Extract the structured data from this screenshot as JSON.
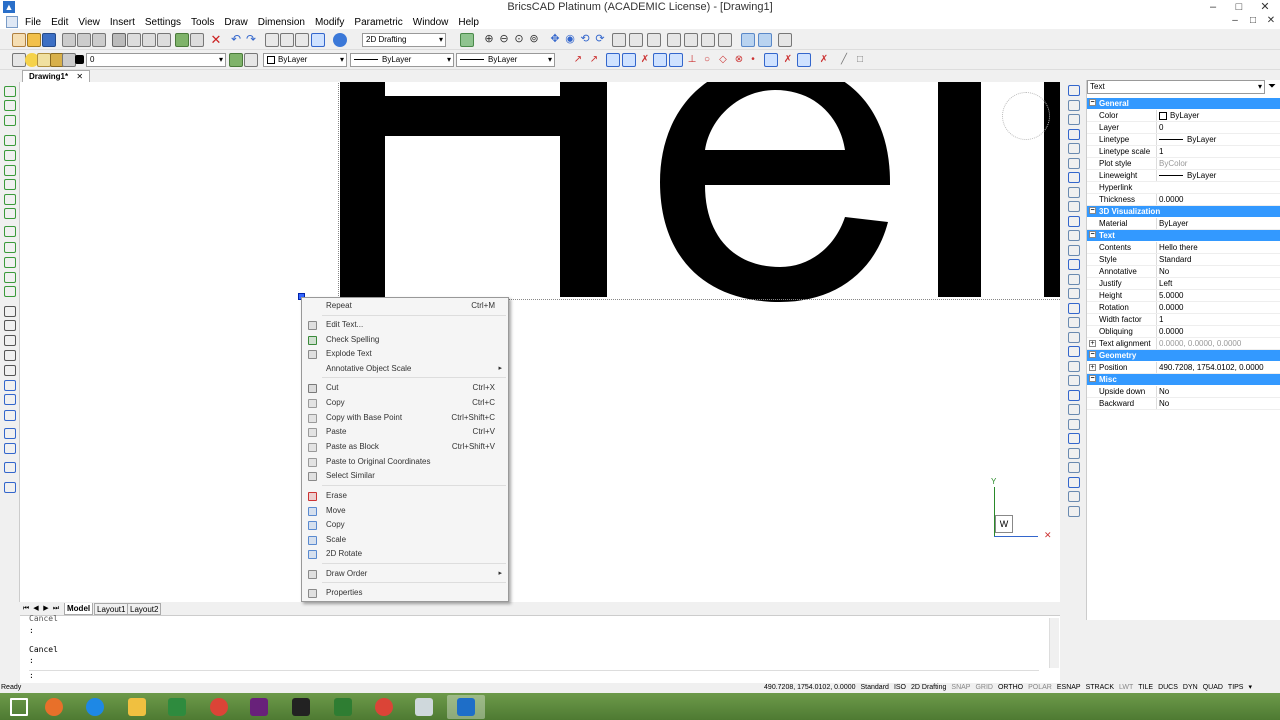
{
  "window": {
    "title": "BricsCAD Platinum (ACADEMIC License) - [Drawing1]",
    "min": "–",
    "max": "□",
    "close": "✕",
    "mdi_min": "–",
    "mdi_max": "□",
    "mdi_close": "✕"
  },
  "menu": [
    "File",
    "Edit",
    "View",
    "Insert",
    "Settings",
    "Tools",
    "Draw",
    "Dimension",
    "Modify",
    "Parametric",
    "Window",
    "Help"
  ],
  "toolbar": {
    "workspace": "2D Drafting",
    "layer": "0",
    "color": "ByLayer",
    "linetype": "ByLayer",
    "lineweight": "ByLayer"
  },
  "doc_tab": {
    "label": "Drawing1*",
    "close": "✕"
  },
  "drawing_text": "Hello there",
  "context_menu": {
    "items": [
      {
        "label": "Repeat",
        "shortcut": "Ctrl+M",
        "icon_color": ""
      },
      {
        "label": "Edit Text...",
        "shortcut": "",
        "icon_color": "#8a8a8a"
      },
      {
        "label": "Check Spelling",
        "shortcut": "",
        "icon_color": "#3a8a3a"
      },
      {
        "label": "Explode Text",
        "shortcut": "",
        "icon_color": "#8a8a8a"
      },
      {
        "label": "Annotative Object Scale",
        "shortcut": "",
        "icon_color": "",
        "submenu": "▸"
      },
      {
        "label": "Cut",
        "shortcut": "Ctrl+X",
        "icon_color": "#7a7a7a"
      },
      {
        "label": "Copy",
        "shortcut": "Ctrl+C",
        "icon_color": "#9a9a9a"
      },
      {
        "label": "Copy with Base Point",
        "shortcut": "Ctrl+Shift+C",
        "icon_color": "#9a9a9a"
      },
      {
        "label": "Paste",
        "shortcut": "Ctrl+V",
        "icon_color": "#9a9a9a"
      },
      {
        "label": "Paste as Block",
        "shortcut": "Ctrl+Shift+V",
        "icon_color": "#9a9a9a"
      },
      {
        "label": "Paste to Original Coordinates",
        "shortcut": "",
        "icon_color": "#9a9a9a"
      },
      {
        "label": "Select Similar",
        "shortcut": "",
        "icon_color": "#8a8a8a"
      },
      {
        "label": "Erase",
        "shortcut": "",
        "icon_color": "#cc3333"
      },
      {
        "label": "Move",
        "shortcut": "",
        "icon_color": "#5a8ad0"
      },
      {
        "label": "Copy",
        "shortcut": "",
        "icon_color": "#5a8ad0"
      },
      {
        "label": "Scale",
        "shortcut": "",
        "icon_color": "#5a8ad0"
      },
      {
        "label": "2D Rotate",
        "shortcut": "",
        "icon_color": "#5a8ad0"
      },
      {
        "label": "Draw Order",
        "shortcut": "",
        "icon_color": "#8a8a8a",
        "submenu": "▸"
      },
      {
        "label": "Properties",
        "shortcut": "",
        "icon_color": "#8a8a8a"
      }
    ]
  },
  "properties": {
    "selection": "Text",
    "general_header": "General",
    "general": [
      {
        "k": "Color",
        "v": "ByLayer"
      },
      {
        "k": "Layer",
        "v": "0"
      },
      {
        "k": "Linetype",
        "v": "ByLayer"
      },
      {
        "k": "Linetype scale",
        "v": "1"
      },
      {
        "k": "Plot style",
        "v": "ByColor"
      },
      {
        "k": "Lineweight",
        "v": "ByLayer"
      },
      {
        "k": "Hyperlink",
        "v": ""
      },
      {
        "k": "Thickness",
        "v": "0.0000"
      }
    ],
    "viz_header": "3D Visualization",
    "viz": [
      {
        "k": "Material",
        "v": "ByLayer"
      }
    ],
    "text_header": "Text",
    "text": [
      {
        "k": "Contents",
        "v": "Hello there"
      },
      {
        "k": "Style",
        "v": "Standard"
      },
      {
        "k": "Annotative",
        "v": "No"
      },
      {
        "k": "Justify",
        "v": "Left"
      },
      {
        "k": "Height",
        "v": "5.0000"
      },
      {
        "k": "Rotation",
        "v": "0.0000"
      },
      {
        "k": "Width factor",
        "v": "1"
      },
      {
        "k": "Obliquing",
        "v": "0.0000"
      },
      {
        "k": "Text alignment",
        "v": "0.0000, 0.0000, 0.0000"
      }
    ],
    "geom_header": "Geometry",
    "geom": [
      {
        "k": "Position",
        "v": "490.7208, 1754.0102, 0.0000"
      }
    ],
    "misc_header": "Misc",
    "misc": [
      {
        "k": "Upside down",
        "v": "No"
      },
      {
        "k": "Backward",
        "v": "No"
      }
    ]
  },
  "layout_tabs": {
    "model": "Model",
    "layout1": "Layout1",
    "layout2": "Layout2"
  },
  "command_lines": [
    "Cancel",
    ":",
    "Cancel",
    ":",
    ":"
  ],
  "status": {
    "ready": "Ready",
    "coords": "490.7208, 1754.0102, 0.0000",
    "items": [
      "Standard",
      "ISO",
      "2D Drafting",
      "SNAP",
      "GRID",
      "ORTHO",
      "POLAR",
      "ESNAP",
      "STRACK",
      "LWT",
      "TILE",
      "DUCS",
      "DYN",
      "QUAD",
      "TIPS"
    ],
    "off_items": [
      "SNAP",
      "GRID",
      "POLAR",
      "LWT"
    ]
  },
  "ucs": {
    "y": "Y",
    "w": "W"
  },
  "taskbar": {
    "apps": [
      {
        "name": "start",
        "color": "#ffffff"
      },
      {
        "name": "firefox",
        "color": "#e8702a"
      },
      {
        "name": "ie",
        "color": "#1e88e5"
      },
      {
        "name": "explorer",
        "color": "#f0c040"
      },
      {
        "name": "excel-like",
        "color": "#2e8b3e"
      },
      {
        "name": "chrome",
        "color": "#db4437"
      },
      {
        "name": "visual-studio",
        "color": "#68217a"
      },
      {
        "name": "cmd",
        "color": "#222222"
      },
      {
        "name": "project",
        "color": "#2e7d32"
      },
      {
        "name": "chrome2",
        "color": "#db4437"
      },
      {
        "name": "window",
        "color": "#cfd8dc"
      },
      {
        "name": "bricscad",
        "color": "#1e6ec8"
      }
    ]
  }
}
